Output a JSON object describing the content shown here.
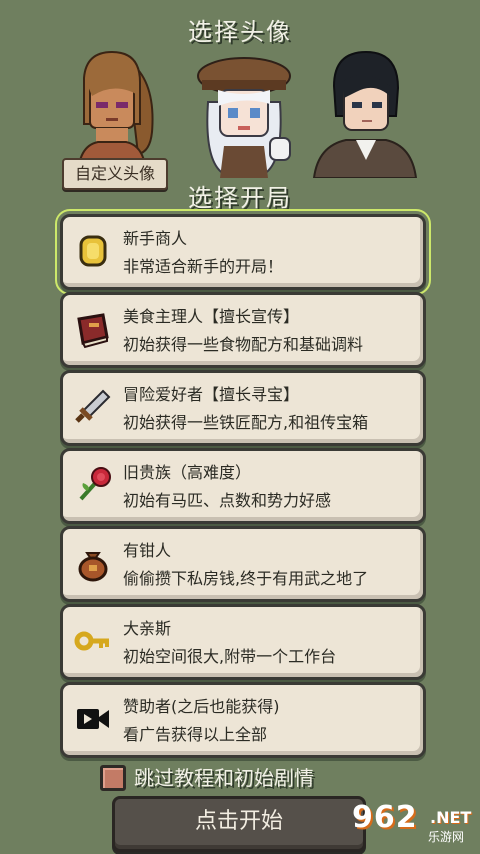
{
  "header": {
    "avatar_title": "选择头像",
    "start_title": "选择开局"
  },
  "avatars": {
    "custom_label": "自定义头像",
    "items": [
      {
        "icon": "brown-ponytail-girl-portrait"
      },
      {
        "icon": "white-hair-girl-beret-portrait"
      },
      {
        "icon": "dark-hair-boy-portrait"
      }
    ]
  },
  "starts": [
    {
      "name": "新手商人",
      "desc": "非常适合新手的开局！",
      "icon": "gold-coin-icon",
      "selected": true
    },
    {
      "name": "美食主理人【擅长宣传】",
      "desc": "初始获得一些食物配方和基础调料",
      "icon": "book-icon"
    },
    {
      "name": "冒险爱好者【擅长寻宝】",
      "desc": "初始获得一些铁匠配方,和祖传宝箱",
      "icon": "sword-icon"
    },
    {
      "name": "旧贵族（高难度）",
      "desc": "初始有马匹、点数和势力好感",
      "icon": "rose-icon"
    },
    {
      "name": "有钳人",
      "desc": "偷偷攒下私房钱,终于有用武之地了",
      "icon": "money-bag-icon"
    },
    {
      "name": "大亲斯",
      "desc": "初始空间很大,附带一个工作台",
      "icon": "key-icon"
    },
    {
      "name": "赞助者(之后也能获得)",
      "desc": "看广告获得以上全部",
      "icon": "video-camera-icon"
    }
  ],
  "options": {
    "skip_label": "跳过教程和初始剧情",
    "skip_checked": false
  },
  "actions": {
    "start_label": "点击开始"
  },
  "watermark": {
    "number": "962",
    "suffix": ".NET",
    "sub": "乐游网"
  },
  "colors": {
    "background": "#6f7f5f",
    "card": "#ede5d6",
    "selected_outline": "#cde86a",
    "button": "#55504a"
  }
}
